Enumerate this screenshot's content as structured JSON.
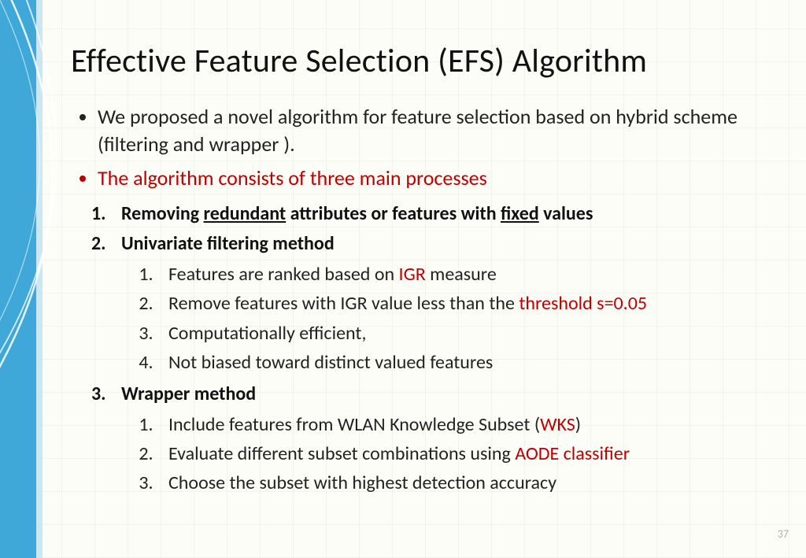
{
  "title": "Effective Feature Selection (EFS) Algorithm",
  "bullets": {
    "b1": "We proposed a novel algorithm for feature selection based on hybrid scheme (filtering and wrapper ).",
    "b2": "The algorithm consists of three main processes"
  },
  "processes": {
    "p1": {
      "pre": "Removing ",
      "u1": "redundant",
      "mid": " attributes or features with ",
      "u2": "fixed",
      "post": " values"
    },
    "p2": "Univariate filtering method",
    "p3": "Wrapper method"
  },
  "p2_items": {
    "i1": {
      "pre": "Features are ranked based on ",
      "red": "IGR",
      "post": " measure"
    },
    "i2": {
      "pre": "Remove features with IGR value less than the ",
      "red": "threshold ѕ=0.05"
    },
    "i3": "Computationally efficient,",
    "i4": "Not biased toward distinct valued features"
  },
  "p3_items": {
    "i1": {
      "pre": "Include features from WLAN Knowledge Subset (",
      "red": "WKS",
      "post": ")"
    },
    "i2": {
      "pre": "Evaluate different subset combinations using ",
      "red": "AODE classifier"
    },
    "i3": "Choose the subset with highest detection accuracy"
  },
  "page_number": "37"
}
